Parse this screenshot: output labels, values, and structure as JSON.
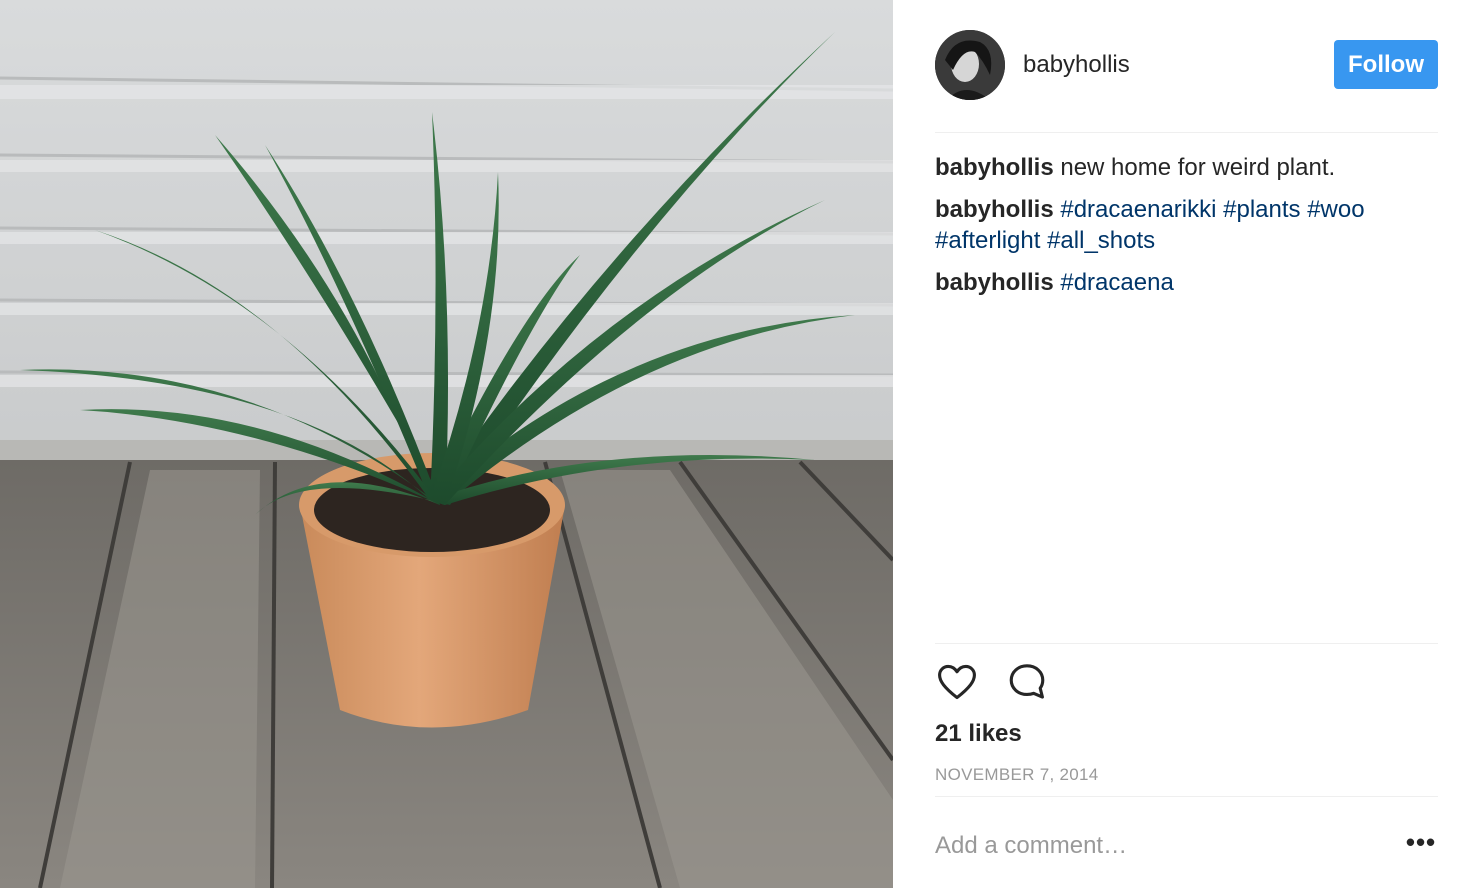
{
  "post": {
    "image_alt": "Potted plant with long green leaves in a terracotta pot on a weathered wooden deck",
    "author": {
      "username": "babyhollis",
      "avatar_icon": "profile-photo"
    },
    "follow_label": "Follow",
    "comments": [
      {
        "username": "babyhollis",
        "text": "new home for weird plant.",
        "hashtags": []
      },
      {
        "username": "babyhollis",
        "text": "",
        "hashtags": [
          "#dracaenarikki",
          "#plants",
          "#woo",
          "#afterlight",
          "#all_shots"
        ]
      },
      {
        "username": "babyhollis",
        "text": "",
        "hashtags": [
          "#dracaena"
        ]
      }
    ],
    "likes_label": "21 likes",
    "date": "NOVEMBER 7, 2014",
    "comment_placeholder": "Add a comment…",
    "more_label": "•••"
  },
  "icons": {
    "like": "heart-icon",
    "comment": "comment-bubble-icon",
    "more": "more-options-icon"
  },
  "colors": {
    "follow_bg": "#3897f0",
    "hashtag": "#003569",
    "muted": "#999999",
    "text": "#262626",
    "divider": "#efefef"
  }
}
